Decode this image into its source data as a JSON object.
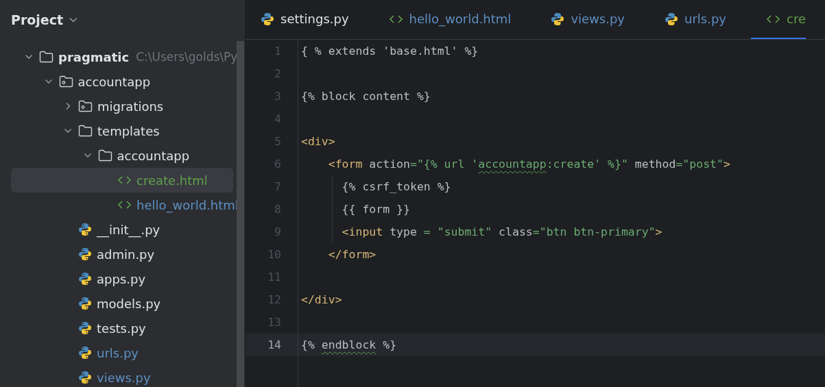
{
  "sidebar": {
    "title": "Project",
    "tree": [
      {
        "label": "pragmatic",
        "path": "C:\\Users\\golds\\Py",
        "kind": "folder",
        "expanded": true,
        "selected": false,
        "children": [
          {
            "label": "accountapp",
            "kind": "module",
            "expanded": true,
            "selected": false,
            "children": [
              {
                "label": "migrations",
                "kind": "module",
                "expanded": false,
                "selected": false
              },
              {
                "label": "templates",
                "kind": "folder",
                "expanded": true,
                "selected": false,
                "children": [
                  {
                    "label": "accountapp",
                    "kind": "folder",
                    "expanded": true,
                    "selected": false,
                    "children": [
                      {
                        "label": "create.html",
                        "kind": "html",
                        "color": "#5fa04e",
                        "selected": true
                      },
                      {
                        "label": "hello_world.html",
                        "kind": "html",
                        "color": "#5e8fc4",
                        "selected": false
                      }
                    ]
                  }
                ]
              },
              {
                "label": "__init__.py",
                "kind": "python",
                "color": "#dfe1e5",
                "selected": false
              },
              {
                "label": "admin.py",
                "kind": "python",
                "color": "#dfe1e5",
                "selected": false
              },
              {
                "label": "apps.py",
                "kind": "python",
                "color": "#dfe1e5",
                "selected": false
              },
              {
                "label": "models.py",
                "kind": "python",
                "color": "#dfe1e5",
                "selected": false
              },
              {
                "label": "tests.py",
                "kind": "python",
                "color": "#dfe1e5",
                "selected": false
              },
              {
                "label": "urls.py",
                "kind": "python",
                "color": "#5e8fc4",
                "selected": false
              },
              {
                "label": "views.py",
                "kind": "python",
                "color": "#5e8fc4",
                "selected": false
              }
            ]
          }
        ]
      }
    ]
  },
  "tabs": [
    {
      "label": "settings.py",
      "kind": "python",
      "color": "#dfe1e5",
      "selected": false
    },
    {
      "label": "hello_world.html",
      "kind": "html",
      "color": "#5e8fc4",
      "selected": false
    },
    {
      "label": "views.py",
      "kind": "python",
      "color": "#5e8fc4",
      "selected": false
    },
    {
      "label": "urls.py",
      "kind": "python",
      "color": "#5e8fc4",
      "selected": false
    },
    {
      "label": "cre",
      "kind": "html",
      "color": "#5fa04e",
      "selected": true
    }
  ],
  "editor": {
    "lines": [
      {
        "number": "1",
        "current": false,
        "guide": false,
        "tokens": [
          {
            "text": "{ % extends 'base.html' %}",
            "kind": "plain"
          }
        ]
      },
      {
        "number": "2",
        "current": false,
        "guide": false
      },
      {
        "number": "3",
        "current": false,
        "guide": false,
        "tokens": [
          {
            "text": "{% block content %}",
            "kind": "plain"
          }
        ]
      },
      {
        "number": "4",
        "current": false,
        "guide": false
      },
      {
        "number": "5",
        "current": false,
        "guide": false,
        "tokens": [
          {
            "text": "<div>",
            "kind": "tag"
          }
        ]
      },
      {
        "number": "6",
        "current": false,
        "guide": false,
        "tokens": [
          {
            "text": "    <form",
            "kind": "tag"
          },
          {
            "text": " action",
            "kind": "attr"
          },
          {
            "text": "=\"{% url '",
            "kind": "string"
          },
          {
            "text": "accountapp",
            "kind": "string",
            "warning": true
          },
          {
            "text": ":create' %}\"",
            "kind": "string"
          },
          {
            "text": " method",
            "kind": "attr"
          },
          {
            "text": "=\"post\"",
            "kind": "string"
          },
          {
            "text": ">",
            "kind": "tag"
          }
        ]
      },
      {
        "number": "7",
        "current": false,
        "guide": true,
        "tokens": [
          {
            "text": "      {% csrf_token %}",
            "kind": "plain"
          }
        ]
      },
      {
        "number": "8",
        "current": false,
        "guide": true,
        "tokens": [
          {
            "text": "      {{ form }}",
            "kind": "plain"
          }
        ]
      },
      {
        "number": "9",
        "current": false,
        "guide": true,
        "tokens": [
          {
            "text": "      <input",
            "kind": "tag"
          },
          {
            "text": " type ",
            "kind": "attr"
          },
          {
            "text": "=",
            "kind": "string"
          },
          {
            "text": " \"submit\"",
            "kind": "string"
          },
          {
            "text": " class",
            "kind": "attr"
          },
          {
            "text": "=\"btn btn-primary\"",
            "kind": "string"
          },
          {
            "text": ">",
            "kind": "tag"
          }
        ]
      },
      {
        "number": "10",
        "current": false,
        "guide": false,
        "tokens": [
          {
            "text": "    </form>",
            "kind": "tag"
          }
        ]
      },
      {
        "number": "11",
        "current": false,
        "guide": false
      },
      {
        "number": "12",
        "current": false,
        "guide": false,
        "tokens": [
          {
            "text": "</div>",
            "kind": "tag"
          }
        ]
      },
      {
        "number": "13",
        "current": false,
        "guide": false
      },
      {
        "number": "14",
        "current": true,
        "guide": false,
        "tokens": [
          {
            "text": "{% ",
            "kind": "plain"
          },
          {
            "text": "endblock",
            "kind": "plain",
            "warning": true
          },
          {
            "text": " %}",
            "kind": "plain"
          }
        ]
      }
    ]
  }
}
